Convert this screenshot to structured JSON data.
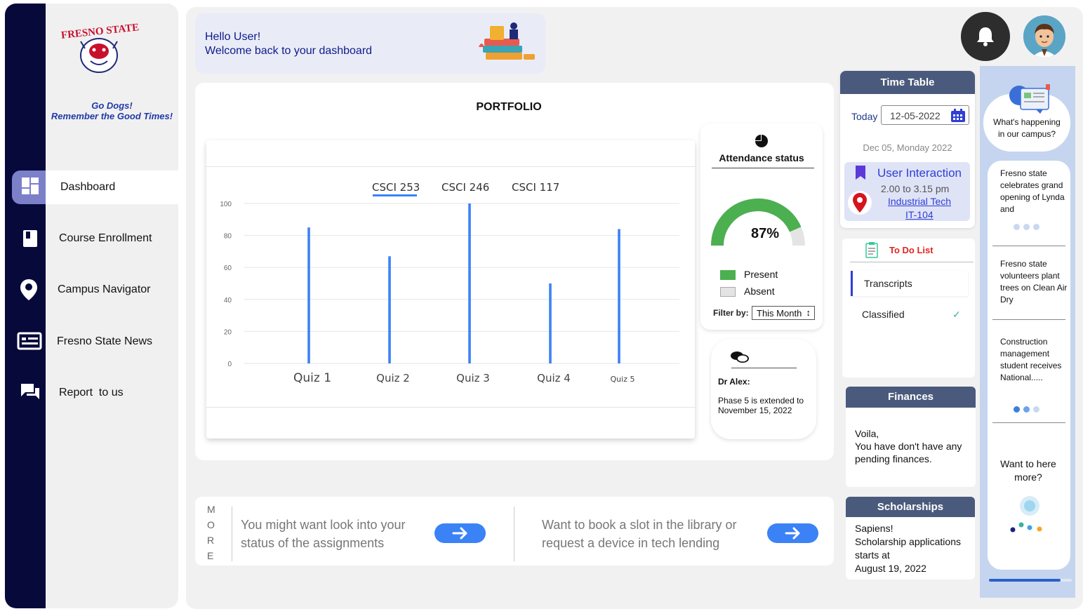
{
  "sidebar": {
    "tagline_1": "Go Dogs!",
    "tagline_2": "Remember the Good Times!",
    "logo_text": "FRESNO STATE",
    "items": [
      {
        "label": "Dashboard",
        "icon": "dashboard-icon"
      },
      {
        "label": "Course Enrollment",
        "icon": "book-icon"
      },
      {
        "label": "Campus Navigator",
        "icon": "location-pin-icon"
      },
      {
        "label": "Fresno State News",
        "icon": "newspaper-icon"
      },
      {
        "label": "Report  to us",
        "icon": "chat-icon"
      }
    ]
  },
  "welcome": {
    "line1": "Hello User!",
    "line2": "Welcome back to your dashboard"
  },
  "portfolio": {
    "title": "PORTFOLIO",
    "tabs": [
      "CSCI 253",
      "CSCI 246",
      "CSCI 117"
    ],
    "active_tab": "CSCI 253"
  },
  "chart_data": {
    "type": "bar",
    "categories": [
      "Quiz 1",
      "Quiz 2",
      "Quiz 3",
      "Quiz 4",
      "Quiz 5"
    ],
    "values": [
      85,
      67,
      100,
      50,
      84
    ],
    "ylim": [
      0,
      100
    ],
    "yticks": [
      0,
      20,
      40,
      60,
      80,
      100
    ],
    "title": "",
    "xlabel": "",
    "ylabel": "",
    "grid": true,
    "color": "#3b82f6"
  },
  "attendance": {
    "title": "Attendance status",
    "percent": 87,
    "percent_label": "87%",
    "legend_present": "Present",
    "legend_absent": "Absent",
    "filter_label": "Filter by:",
    "filter_value": "This Month",
    "present_color": "#4caf50",
    "absent_color": "#e4e4e4"
  },
  "message": {
    "sender": "Dr Alex:",
    "text": "Phase 5 is extended to November 15, 2022"
  },
  "more": {
    "letters": [
      "M",
      "O",
      "R",
      "E"
    ],
    "item1": "You might want look into your status of the  assignments",
    "item2": "Want to book a slot in the library or request a device in tech lending"
  },
  "timetable": {
    "title": "Time Table",
    "today_label": "Today",
    "date": "12-05-2022",
    "date_long": "Dec 05, Monday 2022",
    "event_title": "User Interaction",
    "event_time": "2.00 to 3.15 pm",
    "event_location_1": "Industrial Tech",
    "event_location_2": "IT-104"
  },
  "todo": {
    "title": "To Do List",
    "items": [
      "Transcripts",
      "Classified"
    ]
  },
  "finances": {
    "title": "Finances",
    "line1": "Voila,",
    "line2": "You have don't have any pending finances."
  },
  "scholarships": {
    "title": "Scholarships",
    "line1": "Sapiens!",
    "line2": "Scholarship applications starts at",
    "line3": "August 19, 2022"
  },
  "news": {
    "bubble": "What's happening in our campus?",
    "items": [
      "Fresno state celebrates grand opening of Lynda and",
      "Fresno state volunteers plant trees on Clean Air Dry",
      "Construction management student receives National....."
    ],
    "more_prompt": "Want to here more?"
  }
}
